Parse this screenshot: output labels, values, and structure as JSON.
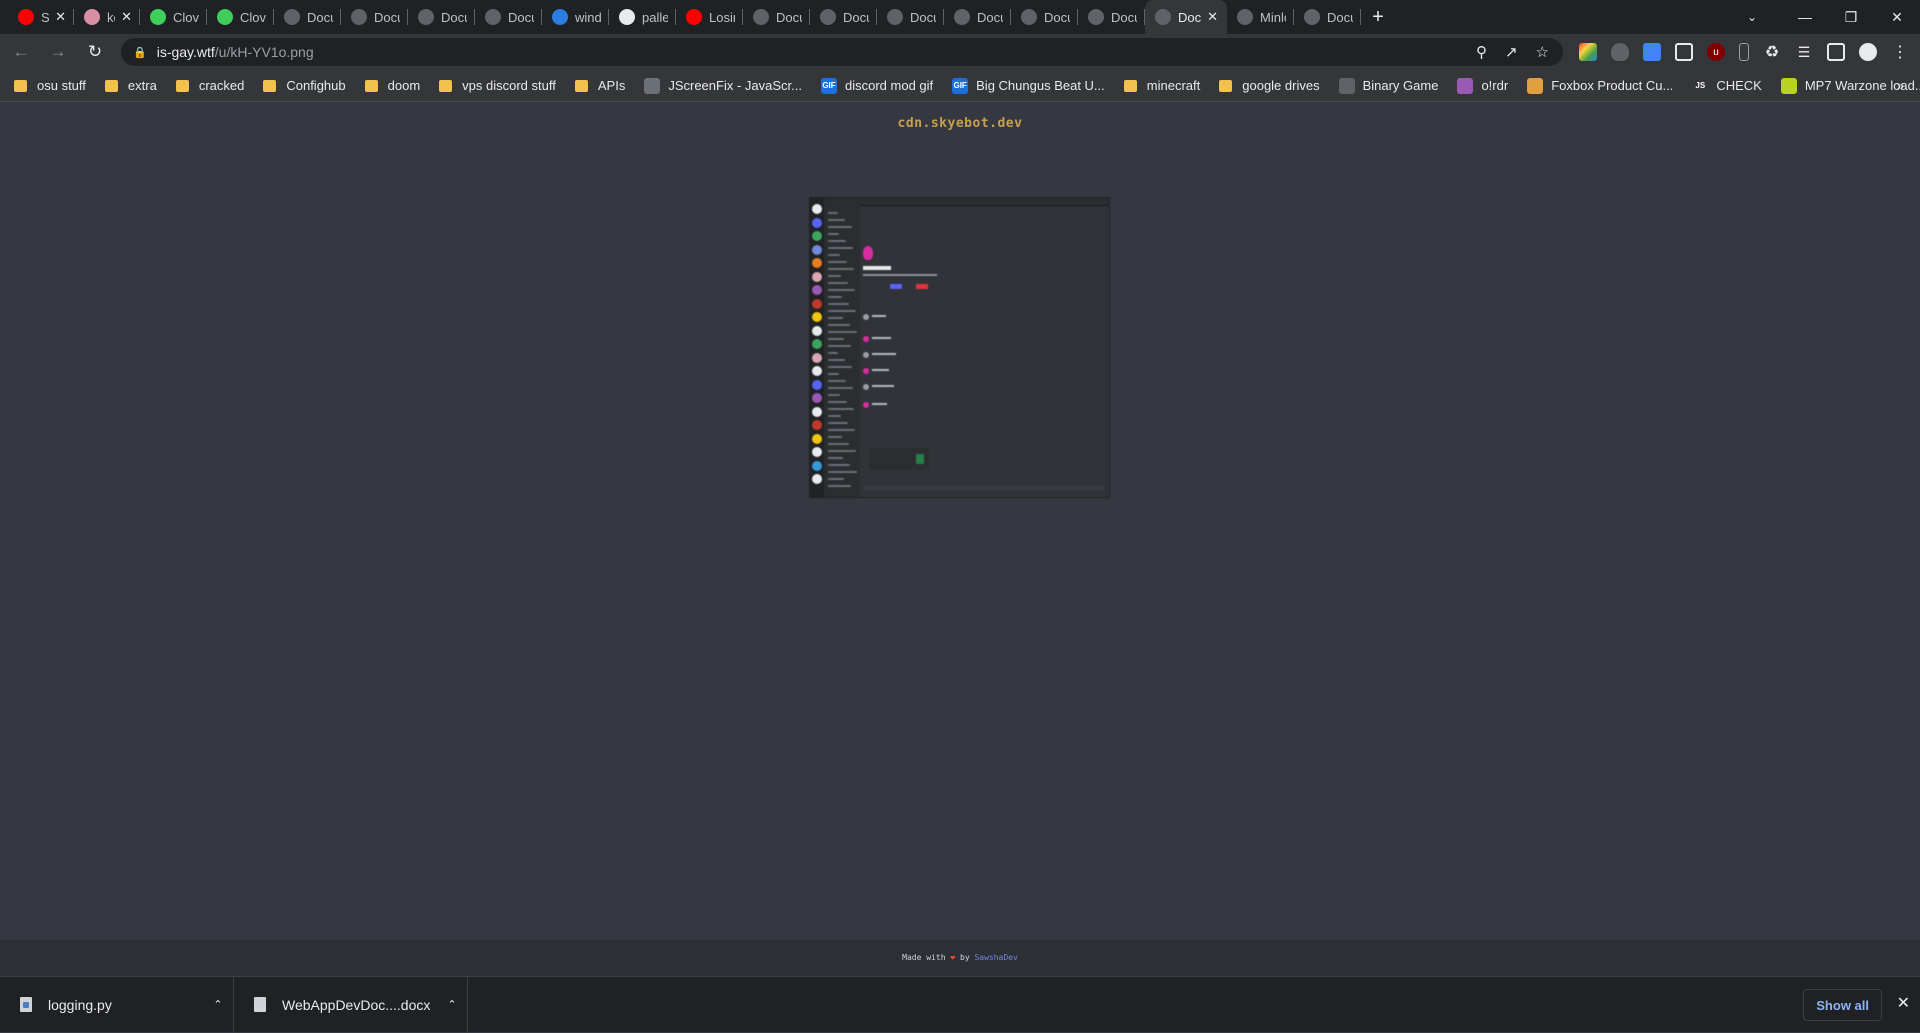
{
  "tabs": [
    {
      "title": "Sch",
      "icon": "youtube-icon",
      "color": "#ff0000",
      "close": true
    },
    {
      "title": "kes",
      "icon": "anime-avatar-icon",
      "color": "#d88fa4",
      "close": true
    },
    {
      "title": "Clovux",
      "icon": "clovux-icon",
      "color": "#3ecf5b",
      "close": false
    },
    {
      "title": "Clovux",
      "icon": "clovux-icon",
      "color": "#3ecf5b",
      "close": false
    },
    {
      "title": "Docume",
      "icon": "globe-icon",
      "color": "#5f6368",
      "close": false
    },
    {
      "title": "Docume",
      "icon": "globe-icon",
      "color": "#5f6368",
      "close": false
    },
    {
      "title": "Docume",
      "icon": "globe-icon",
      "color": "#5f6368",
      "close": false
    },
    {
      "title": "Docume",
      "icon": "globe-icon",
      "color": "#5f6368",
      "close": false
    },
    {
      "title": "window",
      "icon": "bing-icon",
      "color": "#2a7de1",
      "close": false
    },
    {
      "title": "pallets/",
      "icon": "github-icon",
      "color": "#e8eaed",
      "close": false
    },
    {
      "title": "Losing",
      "icon": "youtube-icon",
      "color": "#ff0000",
      "close": false
    },
    {
      "title": "Docume",
      "icon": "globe-icon",
      "color": "#5f6368",
      "close": false
    },
    {
      "title": "Docume",
      "icon": "globe-icon",
      "color": "#5f6368",
      "close": false
    },
    {
      "title": "Docume",
      "icon": "globe-icon",
      "color": "#5f6368",
      "close": false
    },
    {
      "title": "Docume",
      "icon": "globe-icon",
      "color": "#5f6368",
      "close": false
    },
    {
      "title": "Docume",
      "icon": "globe-icon",
      "color": "#5f6368",
      "close": false
    },
    {
      "title": "Docume",
      "icon": "globe-icon",
      "color": "#5f6368",
      "close": false
    },
    {
      "title": "Doc",
      "icon": "globe-icon",
      "color": "#5f6368",
      "close": true,
      "active": true
    },
    {
      "title": "Minlor",
      "icon": "globe-icon",
      "color": "#5f6368",
      "close": false
    },
    {
      "title": "Docume",
      "icon": "globe-icon",
      "color": "#5f6368",
      "close": false
    }
  ],
  "toolbar": {
    "url_host": "is-gay.wtf",
    "url_path": "/u/kH-YV1o.png"
  },
  "bookmarks": [
    {
      "label": "osu stuff",
      "type": "folder"
    },
    {
      "label": "extra",
      "type": "folder"
    },
    {
      "label": "cracked",
      "type": "folder"
    },
    {
      "label": "Confighub",
      "type": "folder"
    },
    {
      "label": "doom",
      "type": "folder"
    },
    {
      "label": "vps discord stuff",
      "type": "folder"
    },
    {
      "label": "APIs",
      "type": "folder"
    },
    {
      "label": "JScreenFix - JavaScr...",
      "type": "site",
      "icon": "monitor-icon",
      "color": "#6b6f76"
    },
    {
      "label": "discord mod gif",
      "type": "site",
      "icon": "gif-icon",
      "color": "#1e6fd9",
      "glyph": "GIF"
    },
    {
      "label": "Big Chungus Beat U...",
      "type": "site",
      "icon": "gif-icon",
      "color": "#1e6fd9",
      "glyph": "GIF"
    },
    {
      "label": "minecraft",
      "type": "folder"
    },
    {
      "label": "google drives",
      "type": "folder"
    },
    {
      "label": "Binary Game",
      "type": "site",
      "icon": "globe-icon",
      "color": "#5f6368"
    },
    {
      "label": "o!rdr",
      "type": "site",
      "icon": "ordr-icon",
      "color": "#9b59b6"
    },
    {
      "label": "Foxbox Product Cu...",
      "type": "site",
      "icon": "box-icon",
      "color": "#e0a040"
    },
    {
      "label": "CHECK",
      "type": "site",
      "icon": "js-icon",
      "color": "#35363a",
      "glyph": "JS"
    },
    {
      "label": "MP7 Warzone load...",
      "type": "site",
      "icon": "warzone-icon",
      "color": "#b7d31f"
    }
  ],
  "page": {
    "site_title": "cdn.skyebot.dev",
    "footer_text": "Made with",
    "footer_by": "by",
    "footer_author": "SawshaDev"
  },
  "downloads": [
    {
      "name": "logging.py",
      "icon": "python-file-icon"
    },
    {
      "name": "WebAppDevDoc....docx",
      "icon": "document-file-icon"
    }
  ],
  "shelf": {
    "show_all": "Show all"
  }
}
